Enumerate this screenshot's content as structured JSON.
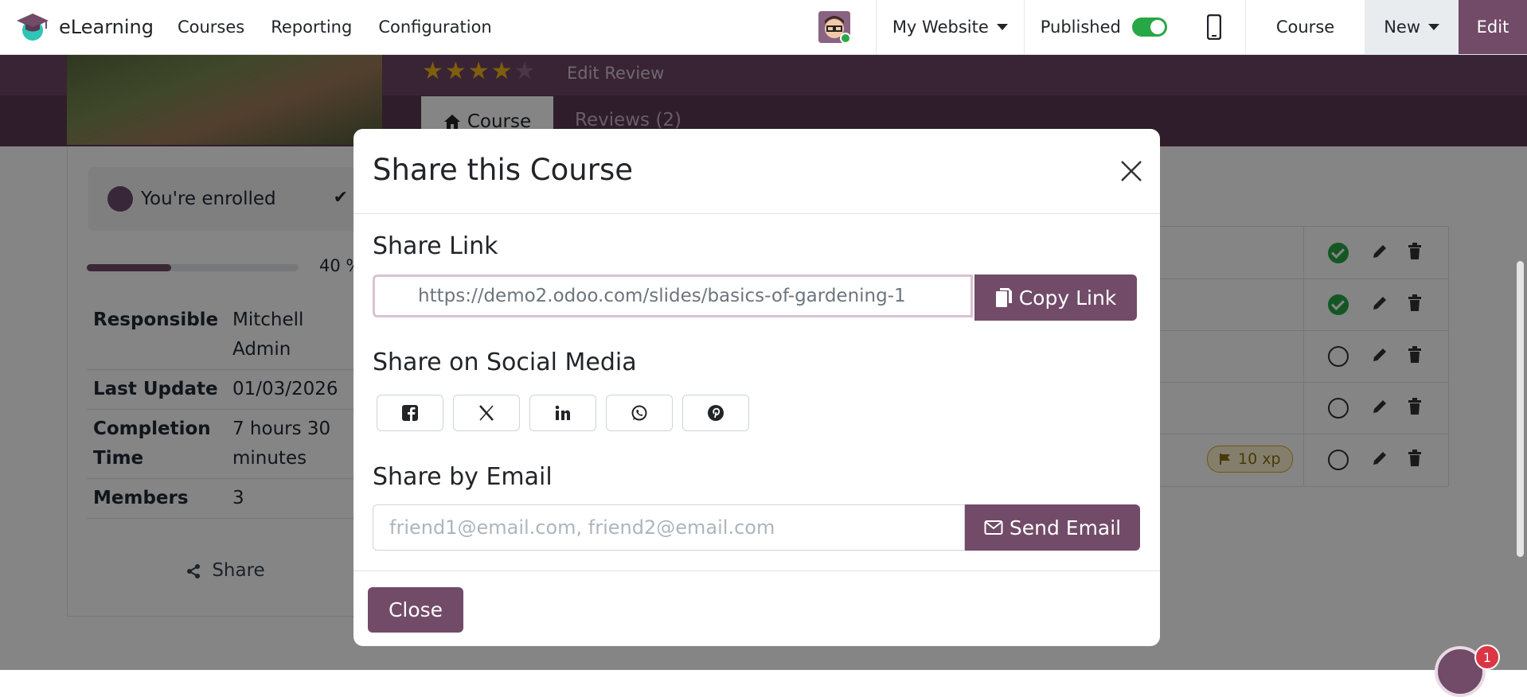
{
  "topbar": {
    "app_name": "eLearning",
    "menu": [
      "Courses",
      "Reporting",
      "Configuration"
    ],
    "website": "My Website",
    "published_label": "Published",
    "published": true,
    "course_label": "Course",
    "new_label": "New",
    "edit_label": "Edit"
  },
  "background": {
    "edit_review": "Edit Review",
    "rating_stars": 4,
    "tab_course": "Course",
    "tab_reviews": "Reviews (2)",
    "enrolled": "You're enrolled",
    "progress_label": "40 %",
    "progress_value": 0.4,
    "info": [
      {
        "key": "Responsible",
        "value": "Mitchell Admin"
      },
      {
        "key": "Last Update",
        "value": "01/03/2026"
      },
      {
        "key": "Completion Time",
        "value": "7 hours 30 minutes"
      },
      {
        "key": "Members",
        "value": "3"
      }
    ],
    "share_label": "Share",
    "xp_badge": "10 xp",
    "chat_count": "1"
  },
  "modal": {
    "title": "Share this Course",
    "share_link_title": "Share Link",
    "link_url": "https://demo2.odoo.com/slides/basics-of-gardening-1",
    "copy_link_label": "Copy Link",
    "social_title": "Share on Social Media",
    "social_icons": [
      "facebook-icon",
      "x-icon",
      "linkedin-icon",
      "whatsapp-icon",
      "pinterest-icon"
    ],
    "email_title": "Share by Email",
    "email_placeholder": "friend1@email.com, friend2@email.com",
    "send_email_label": "Send Email",
    "close_label": "Close"
  },
  "colors": {
    "brand": "#714B67",
    "success": "#28a745",
    "badge": "#dc3545"
  }
}
